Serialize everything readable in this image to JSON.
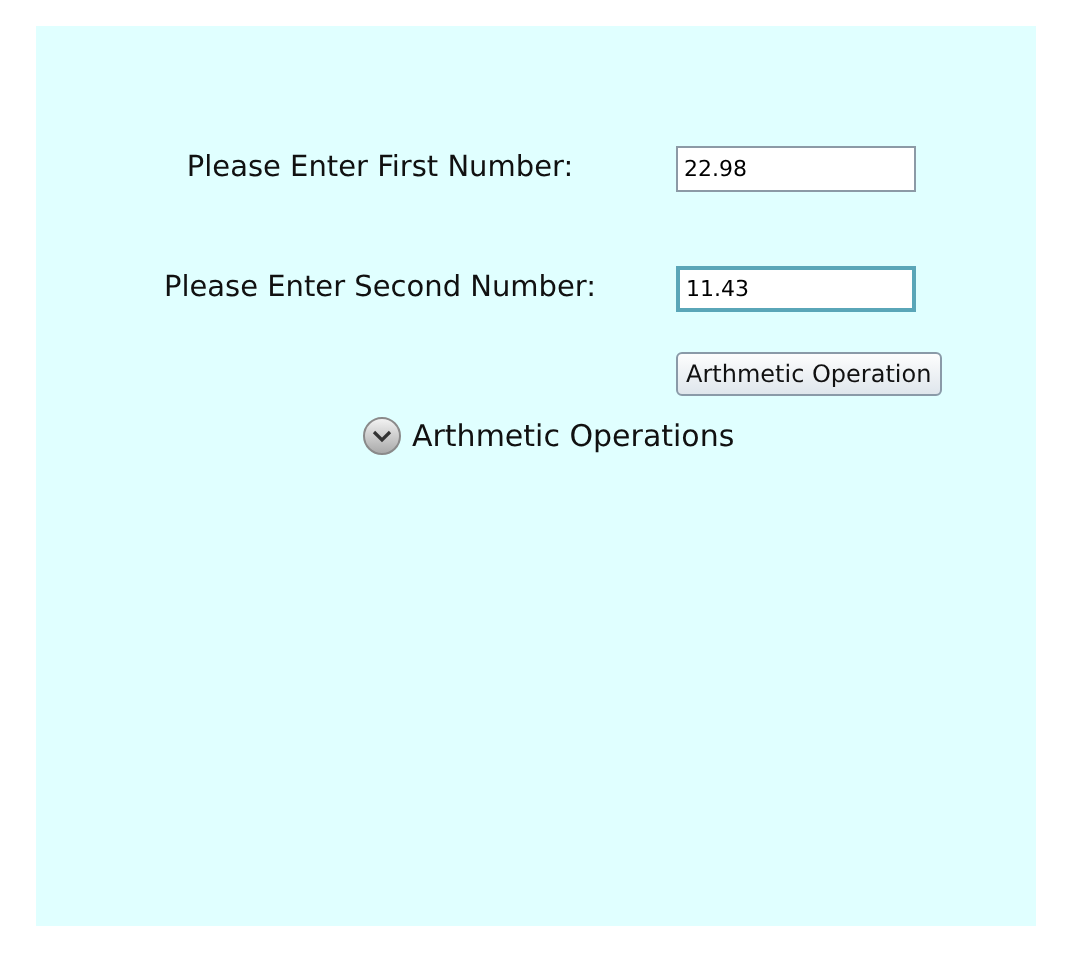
{
  "fields": [
    {
      "label": "Please Enter First Number:",
      "value": "22.98",
      "focused": false
    },
    {
      "label": "Please Enter Second Number:",
      "value": "11.43",
      "focused": true
    }
  ],
  "button": {
    "label": "Arthmetic Operation"
  },
  "expander": {
    "label": "Arthmetic Operations",
    "expanded": false
  }
}
